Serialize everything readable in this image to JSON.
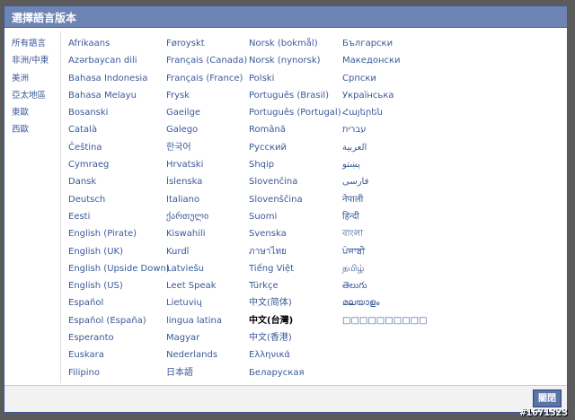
{
  "dialog": {
    "title": "選擇語言版本",
    "close_label": "關閉"
  },
  "sidebar": {
    "items": [
      "所有語言",
      "非洲/中東",
      "美洲",
      "亞太地區",
      "東歐",
      "西歐"
    ]
  },
  "columns": [
    [
      "Afrikaans",
      "Azərbaycan dili",
      "Bahasa Indonesia",
      "Bahasa Melayu",
      "Bosanski",
      "Català",
      "Čeština",
      "Cymraeg",
      "Dansk",
      "Deutsch",
      "Eesti",
      "English (Pirate)",
      "English (UK)",
      "English (Upside Down)",
      "English (US)",
      "Español",
      "Español (España)",
      "Esperanto",
      "Euskara",
      "Filipino"
    ],
    [
      "Føroyskt",
      "Français (Canada)",
      "Français (France)",
      "Frysk",
      "Gaeilge",
      "Galego",
      "한국어",
      "Hrvatski",
      "Íslenska",
      "Italiano",
      "ქართული",
      "Kiswahili",
      "Kurdî",
      "Latviešu",
      "Leet Speak",
      "Lietuvių",
      "lingua latina",
      "Magyar",
      "Nederlands",
      "日本語"
    ],
    [
      "Norsk (bokmål)",
      "Norsk (nynorsk)",
      "Polski",
      "Português (Brasil)",
      "Português (Portugal)",
      "Română",
      "Русский",
      "Shqip",
      "Slovenčina",
      "Slovenščina",
      "Suomi",
      "Svenska",
      "ภาษาไทย",
      "Tiếng Việt",
      "Türkçe",
      "中文(简体)",
      "中文(台灣)",
      "中文(香港)",
      "Ελληνικά",
      "Беларуская"
    ],
    [
      "Български",
      "Македонски",
      "Српски",
      "Українська",
      "Հայերեն",
      "עברית",
      "العربية",
      "پښتو",
      "فارسی",
      "नेपाली",
      "हिन्दी",
      "বাংলা",
      "ਪੰਜਾਬੀ",
      "தமிழ்",
      "తెలుగు",
      "മലയാളം",
      "□□□□□□□□□□"
    ]
  ],
  "selected_language": "中文(台灣)",
  "watermark": "#1671323",
  "colors": {
    "title_bar": "#6d84b4",
    "link": "#3b5998",
    "button": "#5b74a8"
  }
}
